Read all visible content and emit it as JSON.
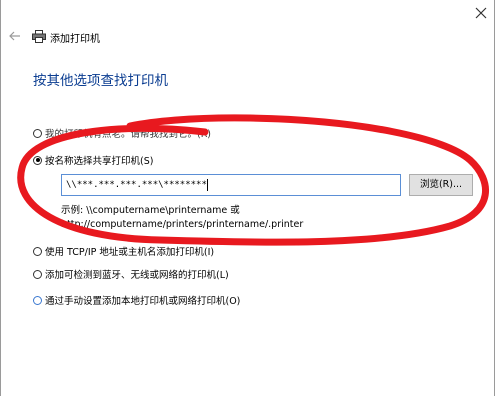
{
  "window": {
    "title": "添加打印机"
  },
  "heading": "按其他选项查找打印机",
  "options": [
    {
      "label": "我的打印机有点老。请帮我找到它。(R)",
      "checked": false
    },
    {
      "label": "按名称选择共享打印机(S)",
      "checked": true
    },
    {
      "label": "使用 TCP/IP 地址或主机名添加打印机(I)",
      "checked": false
    },
    {
      "label": "添加可检测到蓝牙、无线或网络的打印机(L)",
      "checked": false
    },
    {
      "label": "通过手动设置添加本地打印机或网络打印机(O)",
      "checked": false
    }
  ],
  "shared_printer": {
    "path_value": "\\\\***.***.***.***\\********",
    "browse_label": "浏览(R)...",
    "example_line1": "示例: \\\\computername\\printername 或",
    "example_line2": "http://computername/printers/printername/.printer"
  },
  "annotation": {
    "color": "#e8191f"
  }
}
